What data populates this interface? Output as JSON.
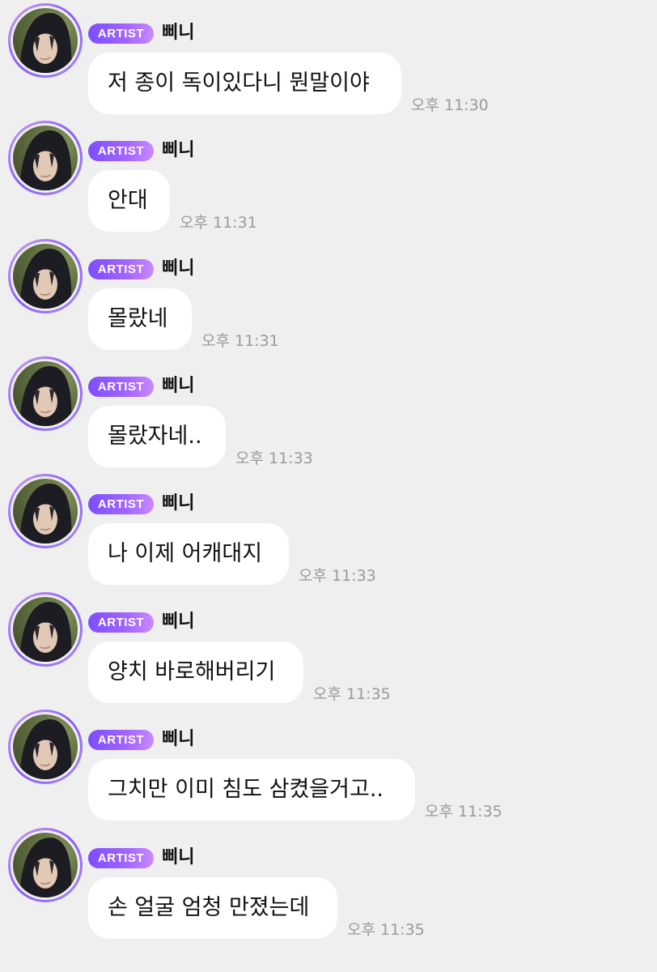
{
  "sender": {
    "badge": "ARTIST",
    "name": "삐니",
    "avatar_icon": "profile-photo"
  },
  "colors": {
    "background": "#efefef",
    "bubble": "#ffffff",
    "badge_gradient_start": "#7c4dff",
    "badge_gradient_end": "#c98aff",
    "avatar_ring": "#8b5cf6",
    "time_text": "#9a9a9a"
  },
  "messages": [
    {
      "text": "저 종이 독이있다니 뭔말이야",
      "time": "오후 11:30"
    },
    {
      "text": "안대",
      "time": "오후 11:31"
    },
    {
      "text": "몰랐네",
      "time": "오후 11:31"
    },
    {
      "text": "몰랐자네..",
      "time": "오후 11:33"
    },
    {
      "text": "나 이제 어캐대지",
      "time": "오후 11:33"
    },
    {
      "text": "양치 바로해버리기",
      "time": "오후 11:35"
    },
    {
      "text": "그치만 이미 침도 삼켰을거고..",
      "time": "오후 11:35"
    },
    {
      "text": "손 얼굴 엄청 만졌는데",
      "time": "오후 11:35"
    }
  ]
}
